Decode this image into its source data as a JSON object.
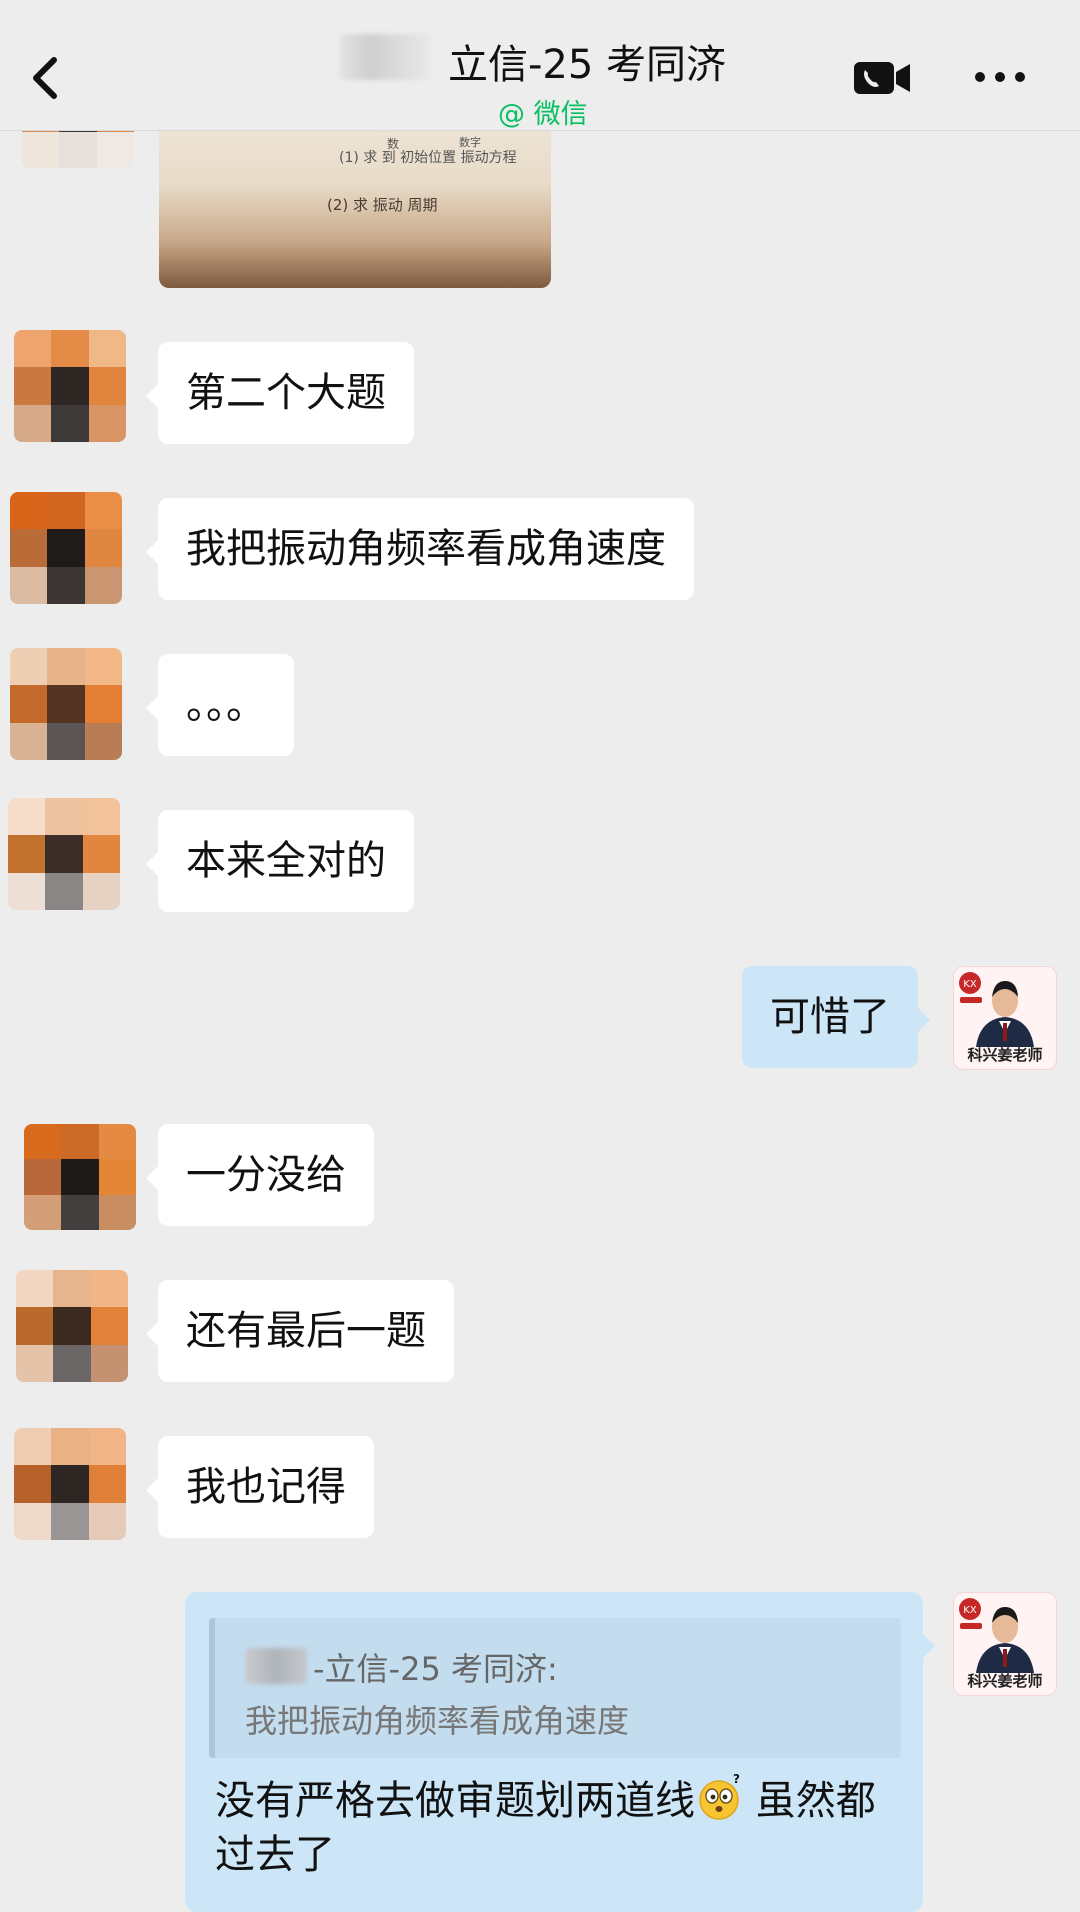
{
  "header": {
    "title": "立信-25 考同济",
    "subtitle": "@ 微信"
  },
  "messages": [
    {
      "side": "left",
      "text": "第二个大题"
    },
    {
      "side": "left",
      "text": "我把振动角频率看成角速度"
    },
    {
      "side": "left",
      "text": "。。。"
    },
    {
      "side": "left",
      "text": "本来全对的"
    },
    {
      "side": "right",
      "text": "可惜了"
    },
    {
      "side": "left",
      "text": "一分没给"
    },
    {
      "side": "left",
      "text": "还有最后一题"
    },
    {
      "side": "left",
      "text": "我也记得"
    }
  ],
  "image_message": {
    "handwriting": [
      "(1) 求  到 初始位置 振动方程",
      "(2) 求 振动 周期"
    ]
  },
  "teacher": {
    "name": "科兴姜老师"
  },
  "quote_message": {
    "quoted_sender": "-立信-25 考同济:",
    "quoted_text": "我把振动角频率看成角速度",
    "reply_before_emoji": "没有严格去做审题划两道线",
    "emoji": "thinking-face-emoji",
    "reply_after_emoji": " 虽然都过去了"
  },
  "colors": {
    "background": "#ededed",
    "bubble_in": "#ffffff",
    "bubble_out": "#cde6f7",
    "wechat_green": "#07c160"
  }
}
